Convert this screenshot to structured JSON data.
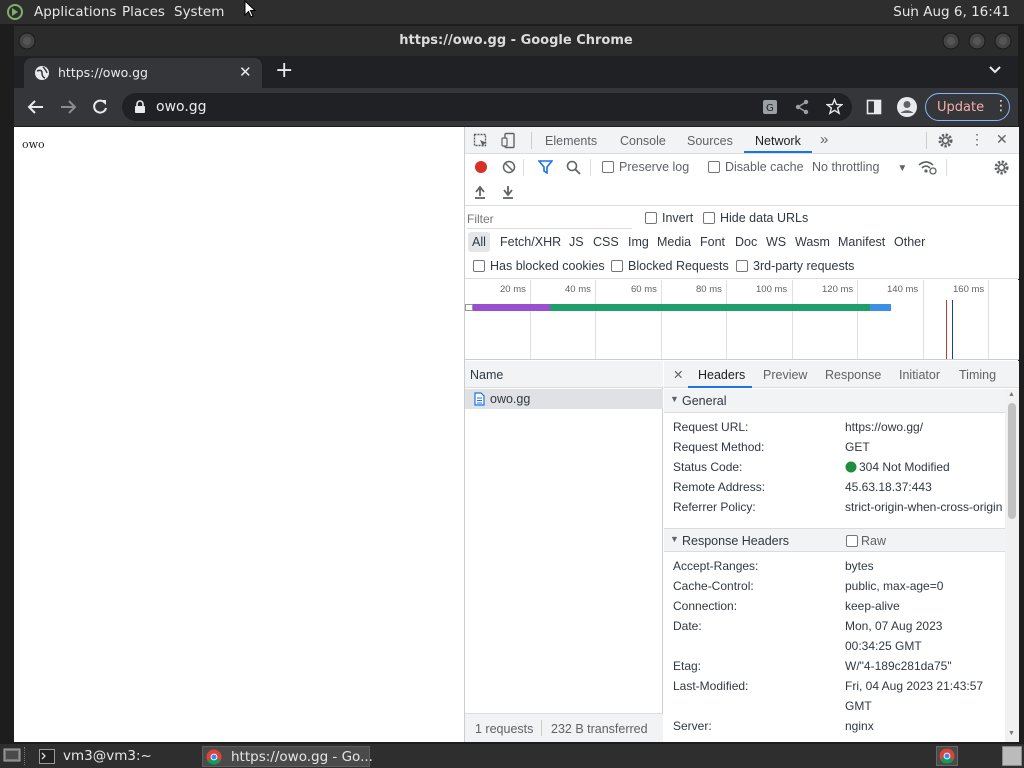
{
  "desktop": {
    "menu": [
      "Applications",
      "Places",
      "System"
    ],
    "clock": "Sun Aug  6, 16:41"
  },
  "window": {
    "title": "https://owo.gg - Google Chrome"
  },
  "browser": {
    "tab_title": "https://owo.gg",
    "url": "owo.gg",
    "update_label": "Update"
  },
  "page": {
    "body_text": "owo"
  },
  "devtools": {
    "tabs": [
      "Elements",
      "Console",
      "Sources",
      "Network"
    ],
    "active_tab": "Network",
    "network_toolbar": {
      "preserve_log": "Preserve log",
      "disable_cache": "Disable cache",
      "throttling": "No throttling"
    },
    "filter": {
      "placeholder": "Filter",
      "invert": "Invert",
      "hide_data_urls": "Hide data URLs",
      "types": [
        "All",
        "Fetch/XHR",
        "JS",
        "CSS",
        "Img",
        "Media",
        "Font",
        "Doc",
        "WS",
        "Wasm",
        "Manifest",
        "Other"
      ],
      "has_blocked_cookies": "Has blocked cookies",
      "blocked_requests": "Blocked Requests",
      "third_party": "3rd-party requests"
    },
    "timeline_ticks": [
      "20 ms",
      "40 ms",
      "60 ms",
      "80 ms",
      "100 ms",
      "120 ms",
      "140 ms",
      "160 ms"
    ],
    "requests": {
      "column_name": "Name",
      "items": [
        "owo.gg"
      ],
      "summary_count": "1 requests",
      "summary_transferred": "232 B transferred"
    },
    "detail_tabs": [
      "Headers",
      "Preview",
      "Response",
      "Initiator",
      "Timing"
    ],
    "general": {
      "title": "General",
      "rows": [
        {
          "k": "Request URL:",
          "v": "https://owo.gg/"
        },
        {
          "k": "Request Method:",
          "v": "GET"
        },
        {
          "k": "Status Code:",
          "v": "304 Not Modified"
        },
        {
          "k": "Remote Address:",
          "v": "45.63.18.37:443"
        },
        {
          "k": "Referrer Policy:",
          "v": "strict-origin-when-cross-origin"
        }
      ]
    },
    "response_headers": {
      "title": "Response Headers",
      "raw": "Raw",
      "rows": [
        {
          "k": "Accept-Ranges:",
          "v": "bytes"
        },
        {
          "k": "Cache-Control:",
          "v": "public, max-age=0"
        },
        {
          "k": "Connection:",
          "v": "keep-alive"
        },
        {
          "k": "Date:",
          "v": "Mon, 07 Aug 2023",
          "v2": "00:34:25 GMT"
        },
        {
          "k": "Etag:",
          "v": "W/\"4-189c281da75\""
        },
        {
          "k": "Last-Modified:",
          "v": "Fri, 04 Aug 2023 21:43:57",
          "v2": "GMT"
        },
        {
          "k": "Server:",
          "v": "nginx"
        }
      ]
    }
  },
  "taskbar": {
    "items": [
      "vm3@vm3:~",
      "https://owo.gg - Go..."
    ]
  },
  "colors": {
    "status_ok": "#1e8e3e",
    "record": "#d93025",
    "accent": "#1a73e8"
  }
}
